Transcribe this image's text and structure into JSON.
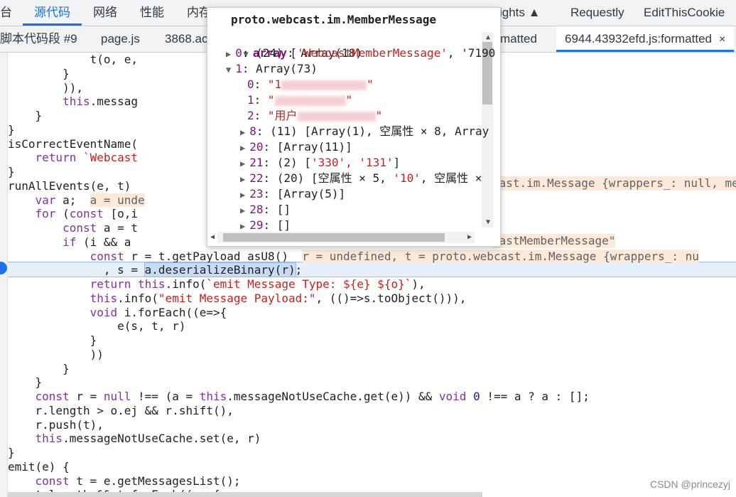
{
  "top_tabs": [
    {
      "label": "台"
    },
    {
      "label": "源代码"
    },
    {
      "label": "网络"
    },
    {
      "label": "性能"
    },
    {
      "label": "内存"
    },
    {
      "label": "ights"
    },
    {
      "label": "Requestly"
    },
    {
      "label": "EditThisCookie"
    }
  ],
  "file_tabs": [
    {
      "label": "脚本代码段 #9"
    },
    {
      "label": "page.js"
    },
    {
      "label": "3868.ac"
    },
    {
      "label": "matted"
    },
    {
      "label": "6944.43932efd.js:formatted",
      "close": "×"
    }
  ],
  "code_lines": [
    [
      "            t(o, e,"
    ],
    [
      "        }"
    ],
    [
      "        )),"
    ],
    [
      "        ",
      "this",
      ".messag"
    ],
    [
      "    }"
    ],
    [
      "}"
    ],
    [
      "isCorrectEventName("
    ],
    [
      "    ",
      "return",
      " ",
      "`Webcast"
    ],
    [
      "}"
    ],
    [
      "runAllEvents(e, t) "
    ],
    [
      "    ",
      "var",
      " a;  ",
      "a = unde"
    ],
    [
      "    ",
      "for",
      " (",
      "const",
      " [o,i"
    ],
    [
      "        ",
      "const",
      " a = t"
    ],
    [
      "        ",
      "if",
      " (i && a"
    ],
    [
      "            ",
      "const",
      " r = t.getPayload_asU8()  ",
      "r = undefined, t = proto.webcast.im.Message {wrappers_: nu"
    ],
    [
      "              , s = ",
      "a.deserializeBinary(r)",
      ";"
    ],
    [
      "            ",
      "return",
      " ",
      "this",
      ".info(",
      "`emit Message Type: ${e} ${o}`",
      "),"
    ],
    [
      "            ",
      "this",
      ".info(",
      "\"emit Message Payload:\"",
      ", (()=>s.toObject())),"
    ],
    [
      "            ",
      "void",
      " i.forEach((e=>{"
    ],
    [
      "                e(s, t, r)"
    ],
    [
      "            }"
    ],
    [
      "            ))"
    ],
    [
      "        }"
    ],
    [
      "    }"
    ],
    [
      "    ",
      "const",
      " r = ",
      "null",
      " !== (a = ",
      "this",
      ".messageNotUseCache.get(e)) && ",
      "void",
      " ",
      "0",
      " !== a ? a : [];"
    ],
    [
      "    r.length > o.ej && r.shift(),"
    ],
    [
      "    r.push(t),"
    ],
    [
      "    ",
      "this",
      ".messageNotUseCache.set(e, r)"
    ],
    [
      "}"
    ],
    [
      "emit(e) {"
    ],
    [
      "    ",
      "const",
      " t = e.getMessagesList();"
    ],
    [
      "    t.length && t.forEach((e=>{"
    ]
  ],
  "right_fragments": {
    "line10": "cast.im.Message {wrappers_: null, mess",
    "line14": "castMemberMessage\""
  },
  "popover": {
    "title": "proto.webcast.im.MemberMessage",
    "root_key": "array",
    "root_val": "Array(18)",
    "rows": [
      {
        "key": "0",
        "val_prefix": "(24) [",
        "val_str": "'WebcastMemberMessage'",
        "val_suffix": ", '7190"
      },
      {
        "key": "1",
        "val_prefix": "Array(73)",
        "val_str": "",
        "val_suffix": ""
      },
      {
        "key": "0",
        "val_prefix": "",
        "val_str": "\"1",
        "val_suffix": "\""
      },
      {
        "key": "1",
        "val_prefix": "",
        "val_str": "\"",
        "val_suffix": "\""
      },
      {
        "key": "2",
        "val_prefix": "",
        "val_str": "\"用户",
        "val_suffix": "\""
      },
      {
        "key": "8",
        "val_prefix": "(11) [Array(1), 空属性 × 8, Array",
        "val_str": "",
        "val_suffix": ""
      },
      {
        "key": "20",
        "val_prefix": "[Array(11)]",
        "val_str": "",
        "val_suffix": ""
      },
      {
        "key": "21",
        "val_prefix": "(2) [",
        "val_str": "'330', '131'",
        "val_suffix": "]"
      },
      {
        "key": "22",
        "val_prefix": "(20) [空属性 × 5, ",
        "val_str": "'10'",
        "val_suffix": ", 空属性 ×"
      },
      {
        "key": "23",
        "val_prefix": "[Array(5)]",
        "val_str": "",
        "val_suffix": ""
      },
      {
        "key": "28",
        "val_prefix": "[]",
        "val_str": "",
        "val_suffix": ""
      },
      {
        "key": "29",
        "val_prefix": "[]",
        "val_str": "",
        "val_suffix": ""
      }
    ]
  },
  "watermark": "CSDN @princezyj"
}
